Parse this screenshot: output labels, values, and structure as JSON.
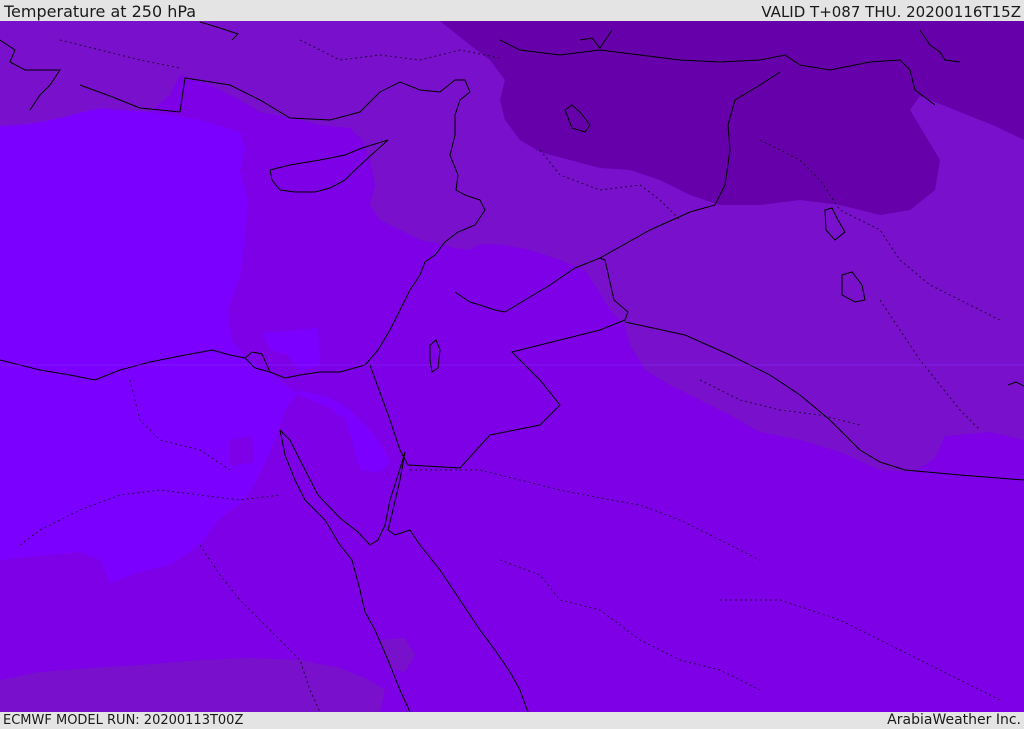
{
  "header": {
    "title": "Temperature at 250 hPa",
    "valid": "VALID T+087 THU. 20200116T15Z"
  },
  "footer": {
    "model_run": "ECMWF MODEL RUN: 20200113T00Z",
    "credit": "ArabiaWeather Inc."
  },
  "colors": {
    "bar_background": "#e4e4e4",
    "temp_band_warmest": "#7b00ff",
    "temp_band_warm": "#7d00e6",
    "temp_band_mid": "#7810cc",
    "temp_band_cold": "#6600aa",
    "coastline": "#000000"
  }
}
